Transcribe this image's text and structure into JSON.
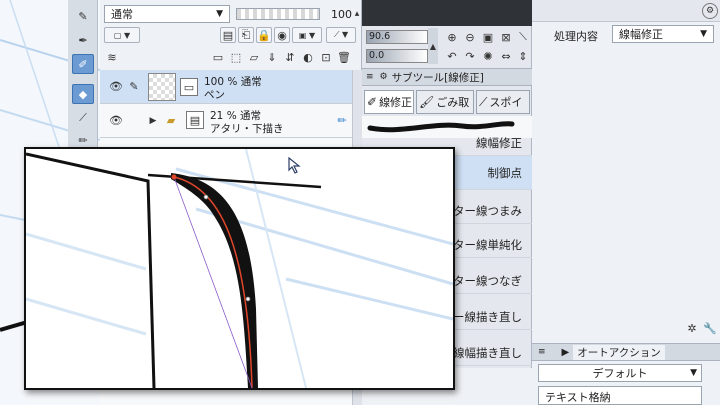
{
  "layer_panel": {
    "blend_mode": "通常",
    "opacity_value": "100",
    "layers": [
      {
        "percent_mode": "100 % 通常",
        "name": "ペン"
      },
      {
        "percent_mode": "21 % 通常",
        "name": "アタリ・下描き"
      }
    ]
  },
  "subtool_panel": {
    "slider_1": "90.6",
    "slider_2": "0.0",
    "title": "サブツール[線修正]",
    "tabs": [
      "線修正",
      "ごみ取",
      "スポイ"
    ],
    "items": [
      "線幅修正",
      "制御点",
      "ウター線つまみ",
      "ター線単純化",
      "ウター線つなぎ",
      "ター線描き直し",
      "線幅描き直し"
    ]
  },
  "prop_panel": {
    "process_label": "処理内容",
    "process_value": "線幅修正",
    "auto_action_title": "オートアクション",
    "auto_action_set": "デフォルト",
    "auto_action_item": "テキスト格納"
  },
  "colors": {
    "accent": "#6b9bd2",
    "selected_row": "#cfe0f5",
    "control_line": "#e0462a"
  }
}
